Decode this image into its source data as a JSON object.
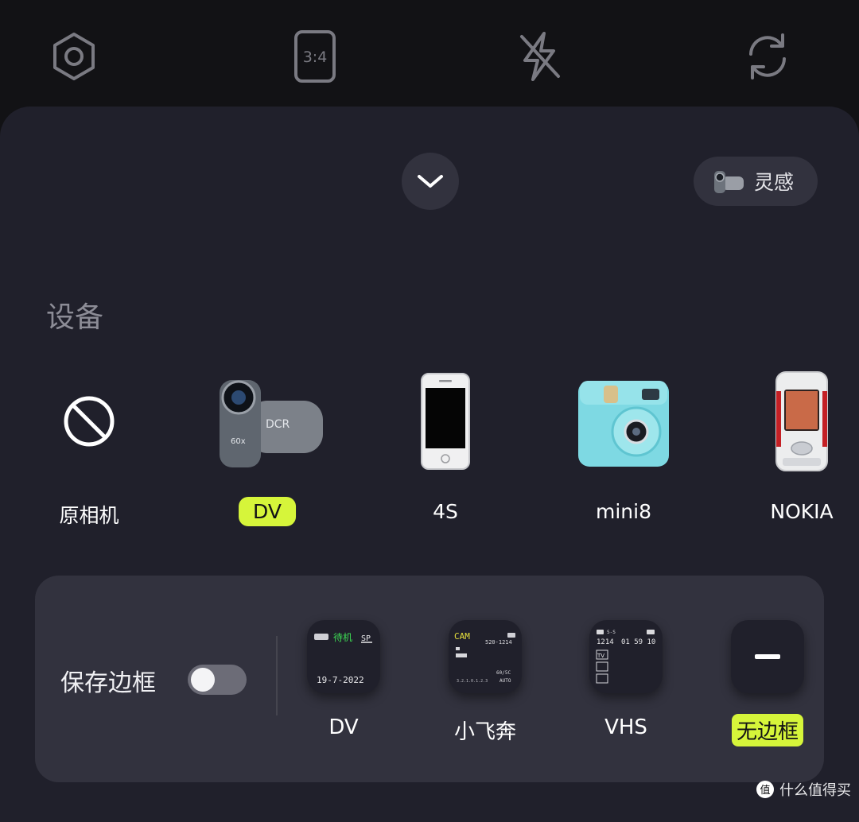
{
  "top_bar": {
    "icons": [
      "settings-icon",
      "aspect-ratio-icon",
      "flash-off-icon",
      "switch-camera-icon"
    ],
    "aspect_ratio_label": "3:4"
  },
  "panel": {
    "inspiration_label": "灵感",
    "section_title": "设备",
    "devices": [
      {
        "label": "原相机",
        "selected": false
      },
      {
        "label": "DV",
        "selected": true
      },
      {
        "label": "4S",
        "selected": false
      },
      {
        "label": "mini8",
        "selected": false
      },
      {
        "label": "NOKIA",
        "selected": false
      }
    ],
    "dv_camera_text": "DCR",
    "dv_camera_badge": "60x"
  },
  "frames": {
    "save_label": "保存边框",
    "save_enabled": false,
    "options": [
      {
        "label": "DV",
        "selected": false,
        "preview": {
          "tag": "待机",
          "mode": "SP",
          "date": "19-7-2022"
        }
      },
      {
        "label": "小飞奔",
        "selected": false,
        "preview": {
          "cam": "CAM",
          "code": "520-1214",
          "rate": "60/5C",
          "auto": "AUTO",
          "scale": "3.2.1.0.1.2.3"
        }
      },
      {
        "label": "VHS",
        "selected": false,
        "preview": {
          "top": "1214",
          "time": "01 59 10",
          "tv": "TV",
          "small": "S-S"
        }
      },
      {
        "label": "无边框",
        "selected": true
      }
    ]
  },
  "watermark": {
    "text": "什么值得买",
    "badge": "值"
  },
  "colors": {
    "accent": "#d6f53a",
    "panel": "#20202b",
    "card": "#32323e",
    "background": "#121215"
  }
}
